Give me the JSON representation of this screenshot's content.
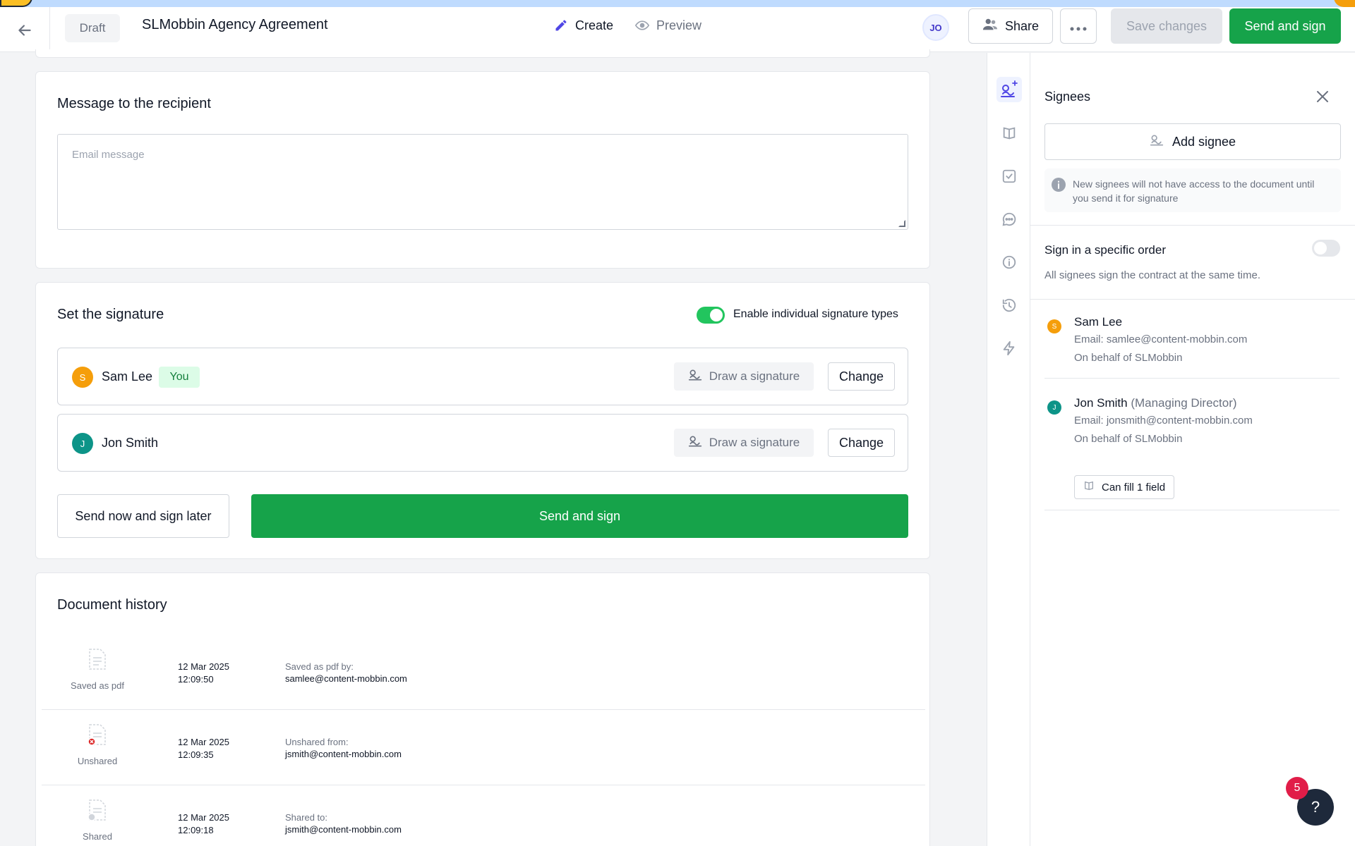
{
  "header": {
    "status": "Draft",
    "title": "SLMobbin Agency Agreement",
    "tabs": [
      {
        "label": "Create",
        "active": true
      },
      {
        "label": "Preview",
        "active": false
      }
    ],
    "avatar_initials": "JO",
    "share_label": "Share",
    "save_label": "Save changes",
    "send_sign_label": "Send and sign"
  },
  "message_card": {
    "title": "Message to the recipient",
    "placeholder": "Email message"
  },
  "signature_card": {
    "title": "Set the signature",
    "toggle_label": "Enable individual signature types",
    "toggle_on": true,
    "signers": [
      {
        "initial": "S",
        "name": "Sam Lee",
        "badge": "You",
        "draw_label": "Draw a signature",
        "change_label": "Change",
        "color": "#f59e0b"
      },
      {
        "initial": "J",
        "name": "Jon Smith",
        "badge": "",
        "draw_label": "Draw a signature",
        "change_label": "Change",
        "color": "#0d9488"
      }
    ],
    "send_later_label": "Send now and sign later",
    "send_sign_label": "Send and sign"
  },
  "history_card": {
    "title": "Document history",
    "rows": [
      {
        "kind": "Saved as pdf",
        "date": "12 Mar 2025",
        "time": "12:09:50",
        "detail_label": "Saved as pdf by:",
        "detail_value": "samlee@content-mobbin.com"
      },
      {
        "kind": "Unshared",
        "date": "12 Mar 2025",
        "time": "12:09:35",
        "detail_label": "Unshared from:",
        "detail_value": "jsmith@content-mobbin.com"
      },
      {
        "kind": "Shared",
        "date": "12 Mar 2025",
        "time": "12:09:18",
        "detail_label": "Shared to:",
        "detail_value": "jsmith@content-mobbin.com"
      }
    ]
  },
  "side_panel": {
    "title": "Signees",
    "add_label": "Add signee",
    "info_text": "New signees will not have access to the document until you send it for signature",
    "order_title": "Sign in a specific order",
    "order_sub": "All signees sign the contract at the same time.",
    "order_toggle_on": false,
    "signees": [
      {
        "initial": "S",
        "name": "Sam Lee",
        "role": "",
        "email": "Email: samlee@content-mobbin.com",
        "behalf": "On behalf of SLMobbin",
        "fill_label": ""
      },
      {
        "initial": "J",
        "name": "Jon Smith",
        "role": "(Managing Director)",
        "email": "Email: jonsmith@content-mobbin.com",
        "behalf": "On behalf of SLMobbin",
        "fill_label": "Can fill 1 field"
      }
    ]
  },
  "help": {
    "label": "?",
    "badge_count": "5"
  },
  "colors": {
    "accent_green": "#16a34a",
    "accent_indigo": "#4f46e5"
  }
}
